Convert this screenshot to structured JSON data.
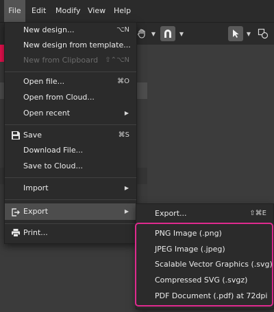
{
  "menubar": {
    "items": [
      {
        "label": "File",
        "active": true
      },
      {
        "label": "Edit"
      },
      {
        "label": "Modify"
      },
      {
        "label": "View"
      },
      {
        "label": "Help"
      }
    ]
  },
  "file_menu": {
    "new_design": {
      "label": "New design...",
      "shortcut": "⌥N"
    },
    "new_from_template": {
      "label": "New design from template..."
    },
    "new_from_clipboard": {
      "label": "New from Clipboard",
      "shortcut": "⇧⌃⌥N",
      "disabled": true
    },
    "open_file": {
      "label": "Open file...",
      "shortcut": "⌘O"
    },
    "open_from_cloud": {
      "label": "Open from Cloud..."
    },
    "open_recent": {
      "label": "Open recent"
    },
    "save": {
      "label": "Save",
      "shortcut": "⌘S",
      "icon": "floppy-disk-icon"
    },
    "download_file": {
      "label": "Download File..."
    },
    "save_to_cloud": {
      "label": "Save to Cloud..."
    },
    "import": {
      "label": "Import"
    },
    "export": {
      "label": "Export",
      "icon": "export-icon",
      "highlighted": true
    },
    "print": {
      "label": "Print...",
      "icon": "printer-icon"
    }
  },
  "export_submenu": {
    "export": {
      "label": "Export...",
      "shortcut": "⇧⌘E"
    },
    "png": {
      "label": "PNG Image (.png)"
    },
    "jpeg": {
      "label": "JPEG Image (.jpeg)"
    },
    "svg": {
      "label": "Scalable Vector Graphics (.svg)"
    },
    "svgz": {
      "label": "Compressed SVG (.svgz)"
    },
    "pdf": {
      "label": "PDF Document (.pdf) at 72dpi"
    }
  },
  "toolbar": {
    "icons": [
      "hand-tool-icon",
      "magnet-icon",
      "pointer-tool-icon",
      "shape-tool-icon"
    ]
  },
  "colors": {
    "accent": "#e8114f",
    "highlight_box": "#e02a8f",
    "menu_bg": "#2b2b2b",
    "hover_bg": "#4d4d4d"
  }
}
